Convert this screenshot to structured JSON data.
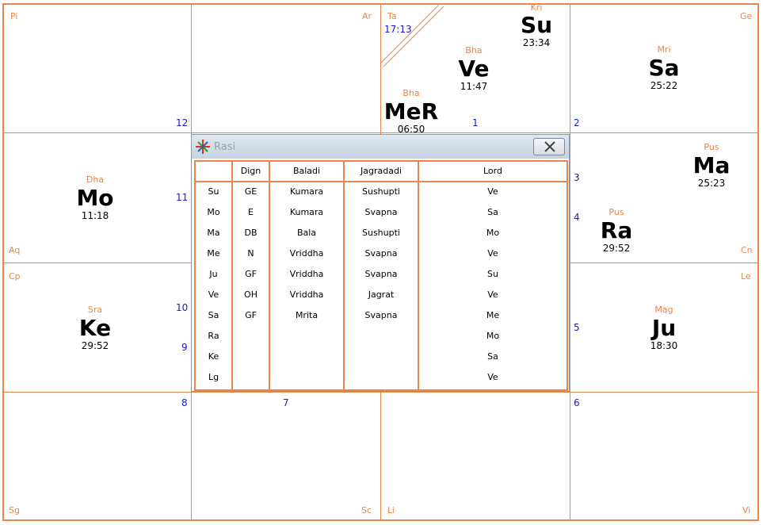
{
  "signs": {
    "pi": "Pi",
    "ar": "Ar",
    "ta": "Ta",
    "ge": "Ge",
    "aq": "Aq",
    "cn": "Cn",
    "cp": "Cp",
    "le": "Le",
    "sg": "Sg",
    "sc": "Sc",
    "li": "Li",
    "vi": "Vi"
  },
  "house_numbers": {
    "h1": "1",
    "h2": "2",
    "h3": "3",
    "h4": "4",
    "h5": "5",
    "h6": "6",
    "h7": "7",
    "h8": "8",
    "h9": "9",
    "h10": "10",
    "h11": "11",
    "h12": "12"
  },
  "lagna_time": "17:13",
  "planets": {
    "su": {
      "nak": "Kri",
      "name": "Su",
      "deg": "23:34"
    },
    "ve": {
      "nak": "Bha",
      "name": "Ve",
      "deg": "11:47"
    },
    "mer": {
      "nak": "Bha",
      "name": "MeR",
      "deg": "06:50"
    },
    "sa": {
      "nak": "Mri",
      "name": "Sa",
      "deg": "25:22"
    },
    "mo": {
      "nak": "Dha",
      "name": "Mo",
      "deg": "11:18"
    },
    "ma": {
      "nak": "Pus",
      "name": "Ma",
      "deg": "25:23"
    },
    "ra": {
      "nak": "Pus",
      "name": "Ra",
      "deg": "29:52"
    },
    "ke": {
      "nak": "Sra",
      "name": "Ke",
      "deg": "29:52"
    },
    "ju": {
      "nak": "Mag",
      "name": "Ju",
      "deg": "18:30"
    }
  },
  "dialog": {
    "title": "Rasi",
    "headers": [
      "",
      "Dign",
      "Baladi",
      "Jagradadi",
      "Lord"
    ],
    "rows": [
      [
        "Su",
        "GE",
        "Kumara",
        "Sushupti",
        "Ve"
      ],
      [
        "Mo",
        "E",
        "Kumara",
        "Svapna",
        "Sa"
      ],
      [
        "Ma",
        "DB",
        "Bala",
        "Sushupti",
        "Mo"
      ],
      [
        "Me",
        "N",
        "Vriddha",
        "Svapna",
        "Ve"
      ],
      [
        "Ju",
        "GF",
        "Vriddha",
        "Svapna",
        "Su"
      ],
      [
        "Ve",
        "OH",
        "Vriddha",
        "Jagrat",
        "Ve"
      ],
      [
        "Sa",
        "GF",
        "Mrita",
        "Svapna",
        "Me"
      ],
      [
        "Ra",
        "",
        "",
        "",
        "Mo"
      ],
      [
        "Ke",
        "",
        "",
        "",
        "Sa"
      ],
      [
        "Lg",
        "",
        "",
        "",
        "Ve"
      ]
    ]
  }
}
